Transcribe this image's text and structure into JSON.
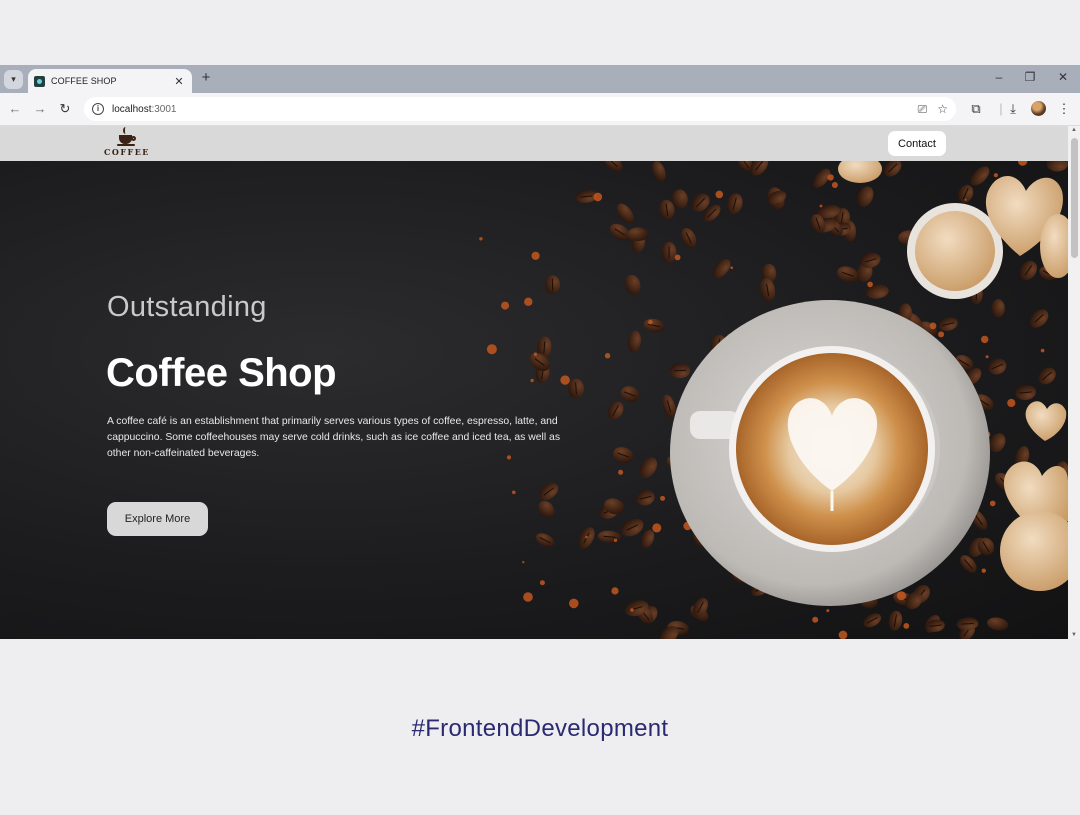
{
  "browser": {
    "tab_title": "COFFEE SHOP",
    "new_tab_symbol": "+",
    "url_host": "localhost",
    "url_port": ":3001"
  },
  "site": {
    "logo_text": "COFFEE",
    "nav": {
      "contact_label": "Contact"
    },
    "hero": {
      "subtitle": "Outstanding",
      "title": "Coffee Shop",
      "description": "A coffee café is an establishment that primarily serves various types of coffee, espresso, latte, and cappuccino. Some coffeehouses may serve cold drinks, such as ice coffee and iced tea, as well as other non-caffeinated beverages.",
      "cta_label": "Explore More"
    }
  },
  "caption": "#FrontendDevelopment",
  "colors": {
    "page_background": "#eeeef0",
    "tab_strip": "#a9aebb",
    "site_header": "#d9d9d9",
    "hero_background": "#1c1c1e",
    "caption_text": "#2a2a72",
    "coffee_bean": "#3b2215",
    "crema": "#c98a45"
  },
  "icons": {
    "tab_list": "chevron-down-icon",
    "tab_close": "close-icon",
    "back": "arrow-left-icon",
    "forward": "arrow-right-icon",
    "reload": "reload-icon",
    "site_info": "info-icon",
    "install": "install-app-icon",
    "bookmark": "star-icon",
    "extensions": "puzzle-icon",
    "downloads": "download-icon",
    "menu": "kebab-menu-icon"
  }
}
